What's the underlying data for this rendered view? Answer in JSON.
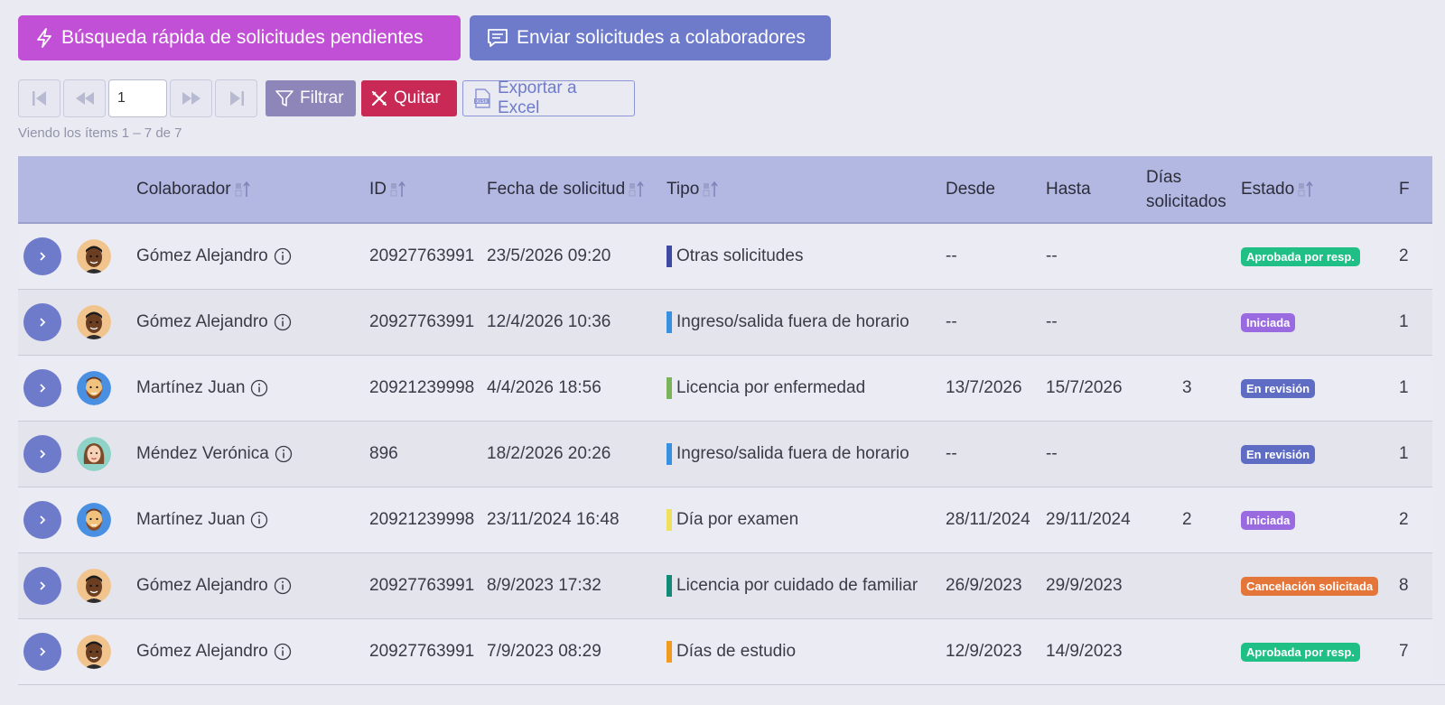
{
  "toolbar": {
    "quick_search_label": "Búsqueda rápida de solicitudes pendientes",
    "send_label": "Enviar solicitudes a colaboradores"
  },
  "pager": {
    "page_value": "1",
    "filter_label": "Filtrar",
    "clear_label": "Quitar",
    "export_label": "Exportar a Excel",
    "viewing_text": "Viendo los ítems 1 – 7  de  7"
  },
  "table": {
    "headers": {
      "colaborador": "Colaborador",
      "id": "ID",
      "fecha": "Fecha de solicitud",
      "tipo": "Tipo",
      "desde": "Desde",
      "hasta": "Hasta",
      "dias_line1": "Días",
      "dias_line2": "solicitados",
      "estado": "Estado",
      "extra": "F"
    },
    "rows": [
      {
        "name": "Gómez Alejandro",
        "avatar": "man-dark",
        "id": "20927763991",
        "fecha": "23/5/2026 09:20",
        "tipo": "Otras solicitudes",
        "tipo_color": "#3d4aa0",
        "desde": "--",
        "hasta": "--",
        "dias": "",
        "estado": "Aprobada por resp.",
        "estado_color": "#1fbf86",
        "extra": "2"
      },
      {
        "name": "Gómez Alejandro",
        "avatar": "man-dark",
        "id": "20927763991",
        "fecha": "12/4/2026 10:36",
        "tipo": "Ingreso/salida fuera de horario",
        "tipo_color": "#3a90e0",
        "desde": "--",
        "hasta": "--",
        "dias": "",
        "estado": "Iniciada",
        "estado_color": "#9a6be0",
        "extra": "1"
      },
      {
        "name": "Martínez Juan",
        "avatar": "man-beard",
        "id": "20921239998",
        "fecha": "4/4/2026 18:56",
        "tipo": "Licencia por enfermedad",
        "tipo_color": "#7ab35a",
        "desde": "13/7/2026",
        "hasta": "15/7/2026",
        "dias": "3",
        "estado": "En revisión",
        "estado_color": "#5e6cc4",
        "extra": "1"
      },
      {
        "name": "Méndez Verónica",
        "avatar": "woman",
        "id": "896",
        "fecha": "18/2/2026 20:26",
        "tipo": "Ingreso/salida fuera de horario",
        "tipo_color": "#3a90e0",
        "desde": "--",
        "hasta": "--",
        "dias": "",
        "estado": "En revisión",
        "estado_color": "#5e6cc4",
        "extra": "1"
      },
      {
        "name": "Martínez Juan",
        "avatar": "man-beard",
        "id": "20921239998",
        "fecha": "23/11/2024 16:48",
        "tipo": "Día por examen",
        "tipo_color": "#f0e060",
        "desde": "28/11/2024",
        "hasta": "29/11/2024",
        "dias": "2",
        "estado": "Iniciada",
        "estado_color": "#9a6be0",
        "extra": "2"
      },
      {
        "name": "Gómez Alejandro",
        "avatar": "man-dark",
        "id": "20927763991",
        "fecha": "8/9/2023 17:32",
        "tipo": "Licencia por cuidado de familiar",
        "tipo_color": "#138a78",
        "desde": "26/9/2023",
        "hasta": "29/9/2023",
        "dias": "",
        "estado": "Cancelación solicitada",
        "estado_color": "#e5763a",
        "extra": "8"
      },
      {
        "name": "Gómez Alejandro",
        "avatar": "man-dark",
        "id": "20927763991",
        "fecha": "7/9/2023 08:29",
        "tipo": "Días de estudio",
        "tipo_color": "#f09a20",
        "desde": "12/9/2023",
        "hasta": "14/9/2023",
        "dias": "",
        "estado": "Aprobada por resp.",
        "estado_color": "#1fbf86",
        "extra": "7"
      }
    ]
  }
}
